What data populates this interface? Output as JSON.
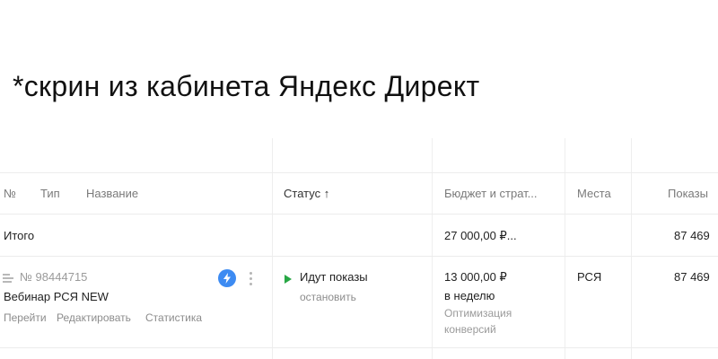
{
  "caption": "*скрин из кабинета Яндекс Директ",
  "table": {
    "headers": {
      "num": "№",
      "type": "Тип",
      "name": "Название",
      "status": "Статус ↑",
      "budget": "Бюджет и страт...",
      "places": "Места",
      "impressions": "Показы"
    },
    "total_row": {
      "label": "Итого",
      "budget": "27 000,00 ₽...",
      "impressions": "87 469"
    },
    "campaign": {
      "icon": "campaign-type-icon",
      "number": "№ 98444715",
      "name": "Вебинар РСЯ NEW",
      "actions": [
        "Перейти",
        "Редактировать",
        "Статистика"
      ],
      "badge_icon": "lightning-icon",
      "menu_icon": "more-vertical-icon",
      "status": "Идут показы",
      "status_action": "остановить",
      "budget": "13 000,00 ₽",
      "budget_period": "в неделю",
      "strategy": [
        "Оптимизация",
        "конверсий"
      ],
      "places": "РСЯ",
      "impressions": "87 469"
    },
    "colors": {
      "accent": "#3d8bf2",
      "status_ok": "#28a745",
      "muted": "#9a9a9a",
      "grid": "#eeeeee"
    }
  }
}
